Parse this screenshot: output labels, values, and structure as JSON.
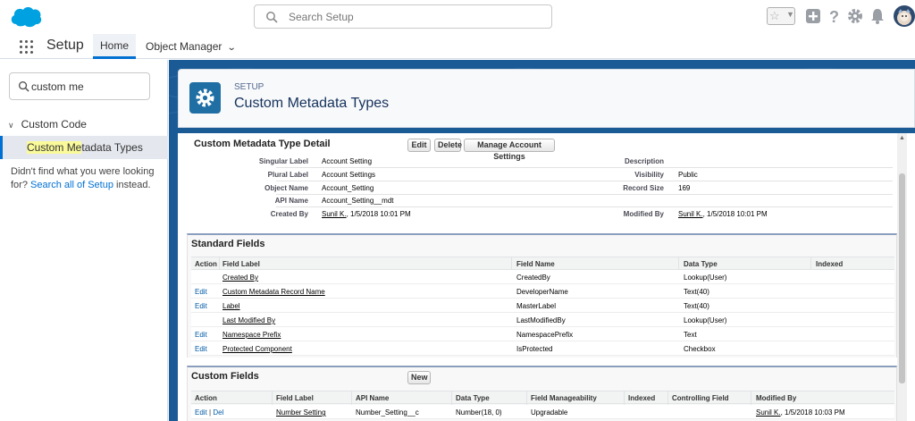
{
  "header": {
    "search_placeholder": "Search Setup",
    "icons": [
      "favorites-star-icon",
      "add-icon",
      "help-icon",
      "gear-icon",
      "bell-icon",
      "avatar"
    ]
  },
  "nav": {
    "app_name": "Setup",
    "tabs": [
      {
        "label": "Home",
        "active": true
      },
      {
        "label": "Object Manager",
        "active": false
      }
    ]
  },
  "left": {
    "quick_find_value": "custom me",
    "tree_head": "Custom Code",
    "tree_item_pre": "Custom ",
    "tree_item_hl": "Me",
    "tree_item_post": "tadata Types",
    "notfound_text": "Didn't find what you were looking for? ",
    "notfound_link": "Search all of Setup",
    "notfound_tail": " instead."
  },
  "page": {
    "setup_label": "SETUP",
    "title": "Custom Metadata Types"
  },
  "detail": {
    "title": "Custom Metadata Type Detail",
    "buttons": {
      "edit": "Edit",
      "delete": "Delete",
      "manage": "Manage Account Settings"
    },
    "fields_left": [
      {
        "label": "Singular Label",
        "value": "Account Setting"
      },
      {
        "label": "Plural Label",
        "value": "Account Settings"
      },
      {
        "label": "Object Name",
        "value": "Account_Setting"
      },
      {
        "label": "API Name",
        "value": "Account_Setting__mdt"
      }
    ],
    "created_by_label": "Created By",
    "created_by_user": "Sunil K.",
    "created_by_date": ", 1/5/2018 10:01 PM",
    "fields_right": [
      {
        "label": "Description",
        "value": ""
      },
      {
        "label": "Visibility",
        "value": "Public"
      },
      {
        "label": "Record Size",
        "value": "169"
      }
    ],
    "modified_by_label": "Modified By",
    "modified_by_user": "Sunil K.",
    "modified_by_date": ", 1/5/2018 10:01 PM"
  },
  "standard_fields": {
    "title": "Standard Fields",
    "columns": [
      "Action",
      "Field Label",
      "Field Name",
      "Data Type",
      "Indexed"
    ],
    "rows": [
      {
        "action": "",
        "label": "Created By",
        "name": "CreatedBy",
        "type": "Lookup(User)",
        "indexed": ""
      },
      {
        "action": "Edit",
        "label": "Custom Metadata Record Name",
        "name": "DeveloperName",
        "type": "Text(40)",
        "indexed": ""
      },
      {
        "action": "Edit",
        "label": "Label",
        "name": "MasterLabel",
        "type": "Text(40)",
        "indexed": ""
      },
      {
        "action": "",
        "label": "Last Modified By",
        "name": "LastModifiedBy",
        "type": "Lookup(User)",
        "indexed": ""
      },
      {
        "action": "Edit",
        "label": "Namespace Prefix",
        "name": "NamespacePrefix",
        "type": "Text",
        "indexed": ""
      },
      {
        "action": "Edit",
        "label": "Protected Component",
        "name": "IsProtected",
        "type": "Checkbox",
        "indexed": ""
      }
    ]
  },
  "custom_fields": {
    "title": "Custom Fields",
    "new_button": "New",
    "columns": [
      "Action",
      "Field Label",
      "API Name",
      "Data Type",
      "Field Manageability",
      "Indexed",
      "Controlling Field",
      "Modified By"
    ],
    "rows": [
      {
        "action_edit": "Edit",
        "action_sep": " | ",
        "action_del": "Del",
        "label": "Number Setting",
        "api": "Number_Setting__c",
        "type": "Number(18, 0)",
        "manageability": "Upgradable",
        "indexed": "",
        "controlling": "",
        "modified_user": "Sunil K.",
        "modified_date": ", 1/5/2018 10:03 PM"
      }
    ]
  },
  "colors": {
    "brand": "#1a5b96",
    "accent": "#0070d2",
    "link": "#015ba7"
  }
}
